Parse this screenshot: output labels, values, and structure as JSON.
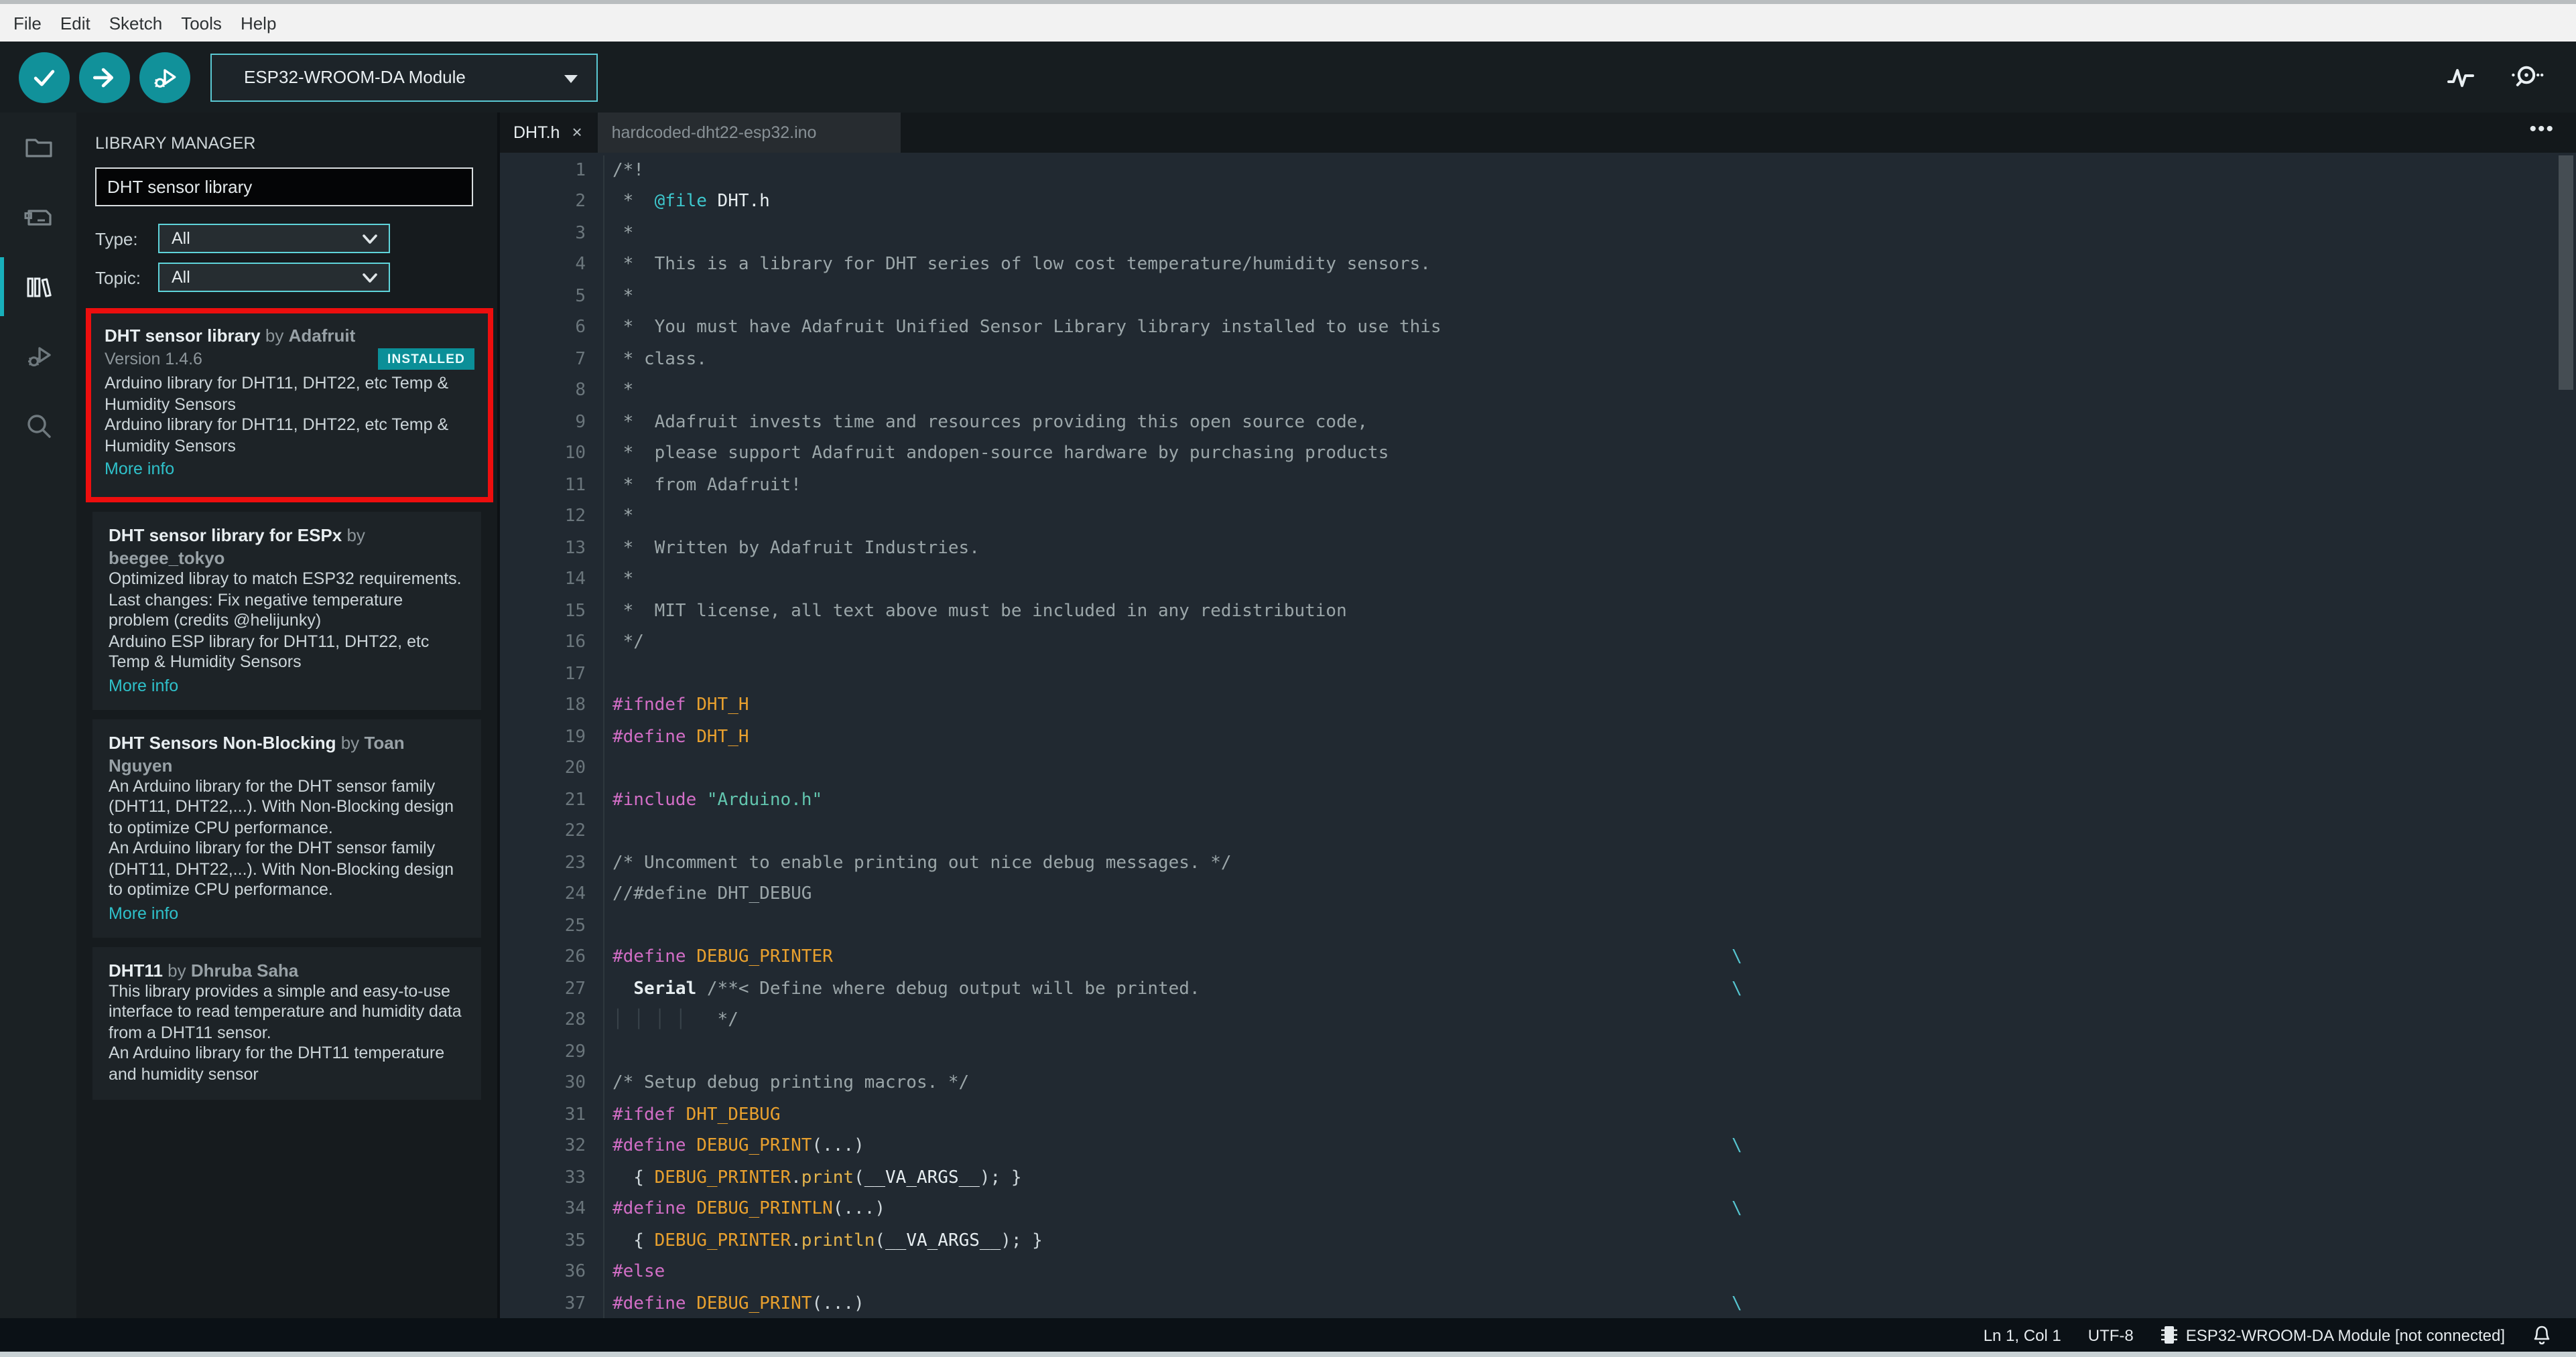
{
  "colors": {
    "accent_teal": "#11919a",
    "highlight_red": "#ed0e0e",
    "installed_badge": "#0b8f98",
    "selection_teal_border": "#5ac8d2"
  },
  "menu": {
    "items": [
      "File",
      "Edit",
      "Sketch",
      "Tools",
      "Help"
    ]
  },
  "toolbar": {
    "board": "ESP32-WROOM-DA Module"
  },
  "library_manager": {
    "title": "LIBRARY MANAGER",
    "search_value": "DHT sensor library",
    "type_label": "Type:",
    "type_value": "All",
    "topic_label": "Topic:",
    "topic_value": "All",
    "by_label": "by",
    "entries": [
      {
        "name": "DHT sensor library",
        "author": "Adafruit",
        "version": "Version 1.4.6",
        "installed": "INSTALLED",
        "highlighted": true,
        "desc": [
          "Arduino library for DHT11, DHT22, etc Temp & Humidity Sensors",
          "Arduino library for DHT11, DHT22, etc Temp & Humidity Sensors"
        ],
        "more": "More info"
      },
      {
        "name": "DHT sensor library for ESPx",
        "author": "beegee_tokyo",
        "highlighted": false,
        "desc": [
          "Optimized libray to match ESP32 requirements. Last changes: Fix negative temperature problem (credits @helijunky)",
          "Arduino ESP library for DHT11, DHT22, etc Temp & Humidity Sensors"
        ],
        "more": "More info"
      },
      {
        "name": "DHT Sensors Non-Blocking",
        "author": "Toan Nguyen",
        "highlighted": false,
        "desc": [
          "An Arduino library for the DHT sensor family (DHT11, DHT22,...). With Non-Blocking design to optimize CPU performance.",
          "An Arduino library for the DHT sensor family (DHT11, DHT22,...). With Non-Blocking design to optimize CPU performance."
        ],
        "more": "More info"
      },
      {
        "name": "DHT11",
        "author": "Dhruba Saha",
        "highlighted": false,
        "desc": [
          "This library provides a simple and easy-to-use interface to read temperature and humidity data from a DHT11 sensor.",
          "An Arduino library for the DHT11 temperature and humidity sensor"
        ]
      }
    ]
  },
  "tabs": [
    {
      "label": "DHT.h",
      "close": "×",
      "active": true
    },
    {
      "label": "hardcoded-dht22-esp32.ino",
      "active": false
    }
  ],
  "editor": {
    "lines": [
      {
        "n": 1,
        "seg": [
          [
            "c",
            "/*!"
          ]
        ]
      },
      {
        "n": 2,
        "seg": [
          [
            "c",
            " *  "
          ],
          [
            "t",
            "@file"
          ],
          [
            "b",
            " DHT.h"
          ]
        ]
      },
      {
        "n": 3,
        "seg": [
          [
            "c",
            " *"
          ]
        ]
      },
      {
        "n": 4,
        "seg": [
          [
            "c",
            " *  This is a library for DHT series of low cost temperature/humidity sensors."
          ]
        ]
      },
      {
        "n": 5,
        "seg": [
          [
            "c",
            " *"
          ]
        ]
      },
      {
        "n": 6,
        "seg": [
          [
            "c",
            " *  You must have Adafruit Unified Sensor Library library installed to use this"
          ]
        ]
      },
      {
        "n": 7,
        "seg": [
          [
            "c",
            " * class."
          ]
        ]
      },
      {
        "n": 8,
        "seg": [
          [
            "c",
            " *"
          ]
        ]
      },
      {
        "n": 9,
        "seg": [
          [
            "c",
            " *  Adafruit invests time and resources providing this open source code,"
          ]
        ]
      },
      {
        "n": 10,
        "seg": [
          [
            "c",
            " *  please support Adafruit andopen-source hardware by purchasing products"
          ]
        ]
      },
      {
        "n": 11,
        "seg": [
          [
            "c",
            " *  from Adafruit!"
          ]
        ]
      },
      {
        "n": 12,
        "seg": [
          [
            "c",
            " *"
          ]
        ]
      },
      {
        "n": 13,
        "seg": [
          [
            "c",
            " *  Written by Adafruit Industries."
          ]
        ]
      },
      {
        "n": 14,
        "seg": [
          [
            "c",
            " *"
          ]
        ]
      },
      {
        "n": 15,
        "seg": [
          [
            "c",
            " *  MIT license, all text above must be included in any redistribution"
          ]
        ]
      },
      {
        "n": 16,
        "seg": [
          [
            "c",
            " */"
          ]
        ]
      },
      {
        "n": 17,
        "seg": []
      },
      {
        "n": 18,
        "seg": [
          [
            "p",
            "#ifndef"
          ],
          [
            "w",
            " "
          ],
          [
            "m",
            "DHT_H"
          ]
        ]
      },
      {
        "n": 19,
        "seg": [
          [
            "p",
            "#define"
          ],
          [
            "w",
            " "
          ],
          [
            "m",
            "DHT_H"
          ]
        ]
      },
      {
        "n": 20,
        "seg": []
      },
      {
        "n": 21,
        "seg": [
          [
            "p",
            "#include"
          ],
          [
            "w",
            " "
          ],
          [
            "s",
            "\"Arduino.h\""
          ]
        ]
      },
      {
        "n": 22,
        "seg": []
      },
      {
        "n": 23,
        "seg": [
          [
            "c",
            "/* Uncomment to enable printing out nice debug messages. */"
          ]
        ]
      },
      {
        "n": 24,
        "seg": [
          [
            "c",
            "//#define DHT_DEBUG"
          ]
        ]
      },
      {
        "n": 25,
        "seg": []
      },
      {
        "n": 26,
        "seg": [
          [
            "p",
            "#define"
          ],
          [
            "w",
            " "
          ],
          [
            "m",
            "DEBUG_PRINTER"
          ]
        ],
        "cont": true
      },
      {
        "n": 27,
        "seg": [
          [
            "w",
            "  "
          ],
          [
            "b2",
            "Serial"
          ],
          [
            "w",
            " "
          ],
          [
            "c",
            "/**< Define where debug output will be printed."
          ]
        ],
        "cont": true
      },
      {
        "n": 28,
        "seg": [
          [
            "g",
            "│ │ │ │"
          ],
          [
            "c",
            "   */"
          ]
        ]
      },
      {
        "n": 29,
        "seg": []
      },
      {
        "n": 30,
        "seg": [
          [
            "c",
            "/* Setup debug printing macros. */"
          ]
        ]
      },
      {
        "n": 31,
        "seg": [
          [
            "p",
            "#ifdef"
          ],
          [
            "w",
            " "
          ],
          [
            "m",
            "DHT_DEBUG"
          ]
        ]
      },
      {
        "n": 32,
        "seg": [
          [
            "p",
            "#define"
          ],
          [
            "w",
            " "
          ],
          [
            "m",
            "DEBUG_PRINT"
          ],
          [
            "w",
            "(...)"
          ]
        ],
        "cont": true
      },
      {
        "n": 33,
        "seg": [
          [
            "w",
            "  { "
          ],
          [
            "m",
            "DEBUG_PRINTER"
          ],
          [
            "w",
            "."
          ],
          [
            "f",
            "print"
          ],
          [
            "w",
            "("
          ],
          [
            "b",
            "__VA_ARGS__"
          ],
          [
            "w",
            "); }"
          ]
        ]
      },
      {
        "n": 34,
        "seg": [
          [
            "p",
            "#define"
          ],
          [
            "w",
            " "
          ],
          [
            "m",
            "DEBUG_PRINTLN"
          ],
          [
            "w",
            "(...)"
          ]
        ],
        "cont": true
      },
      {
        "n": 35,
        "seg": [
          [
            "w",
            "  { "
          ],
          [
            "m",
            "DEBUG_PRINTER"
          ],
          [
            "w",
            "."
          ],
          [
            "f",
            "println"
          ],
          [
            "w",
            "("
          ],
          [
            "b",
            "__VA_ARGS__"
          ],
          [
            "w",
            "); }"
          ]
        ]
      },
      {
        "n": 36,
        "seg": [
          [
            "p",
            "#else"
          ]
        ]
      },
      {
        "n": 37,
        "seg": [
          [
            "p",
            "#define"
          ],
          [
            "w",
            " "
          ],
          [
            "m",
            "DEBUG_PRINT"
          ],
          [
            "w",
            "(...)"
          ]
        ],
        "cont": true
      }
    ]
  },
  "status": {
    "ln_col": "Ln 1, Col 1",
    "encoding": "UTF-8",
    "board_status": "ESP32-WROOM-DA Module [not connected]"
  }
}
